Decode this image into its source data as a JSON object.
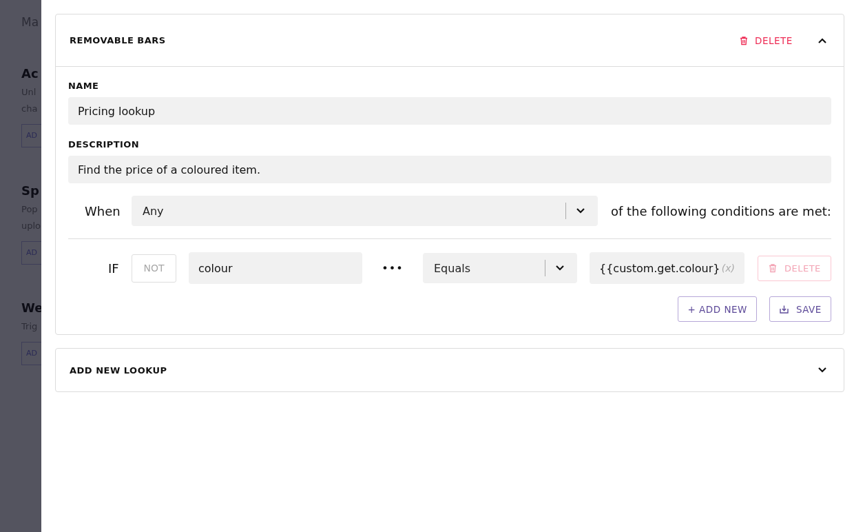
{
  "background": {
    "sections": [
      {
        "title": "Ac",
        "lines": [
          "Unl",
          "cha"
        ],
        "button": "AD"
      },
      {
        "title": "Sp",
        "lines": [
          "Pop",
          "uplo"
        ],
        "button": "AD"
      },
      {
        "title": "We",
        "lines": [
          "Trig"
        ],
        "button": "AD"
      }
    ],
    "intro": "Ma"
  },
  "lookups": [
    {
      "title": "REMOVABLE BARS",
      "expanded": true,
      "delete_label": "DELETE",
      "name_label": "NAME",
      "name": "Pricing lookup",
      "description_label": "DESCRIPTION",
      "description": "Find the price of a coloured item.",
      "when_label": "When",
      "match": "Any",
      "match_suffix": "of the following conditions are met:",
      "conditions": [
        {
          "prefix": "IF",
          "not_label": "NOT",
          "negated": false,
          "field": "colour",
          "more": "•••",
          "operator": "Equals",
          "value": "{{custom.get.colour}",
          "variable_mark": "(x)",
          "delete_label": "DELETE",
          "delete_disabled": true
        }
      ],
      "add_label": "+ ADD NEW",
      "save_label": "SAVE"
    },
    {
      "title": "ADD NEW LOOKUP",
      "expanded": false
    }
  ]
}
